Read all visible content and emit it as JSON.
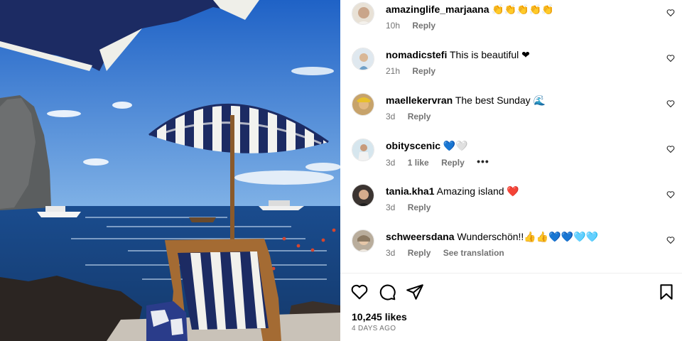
{
  "comments": [
    {
      "username": "amazinglife_marjaana",
      "text": "👏👏👏👏👏",
      "time": "10h",
      "likes": "",
      "reply": "Reply",
      "translate": "",
      "more": "",
      "avatar_color": "#c9a58a"
    },
    {
      "username": "nomadicstefi",
      "text": "This is beautiful ❤",
      "time": "21h",
      "likes": "",
      "reply": "Reply",
      "translate": "",
      "more": "",
      "avatar_color": "#b9cfe0"
    },
    {
      "username": "maellekervran",
      "text": "The best Sunday 🌊",
      "time": "3d",
      "likes": "",
      "reply": "Reply",
      "translate": "",
      "more": "",
      "avatar_color": "#d4a23a"
    },
    {
      "username": "obityscenic",
      "text": "💙🤍",
      "time": "3d",
      "likes": "1 like",
      "reply": "Reply",
      "translate": "",
      "more": "•••",
      "avatar_color": "#8fb3c7"
    },
    {
      "username": "tania.kha1",
      "text": "Amazing island ❤️",
      "time": "3d",
      "likes": "",
      "reply": "Reply",
      "translate": "",
      "more": "",
      "avatar_color": "#5a4d44"
    },
    {
      "username": "schweersdana",
      "text": "Wunderschön!!👍👍💙💙🩵🩵",
      "time": "3d",
      "likes": "",
      "reply": "Reply",
      "translate": "See translation",
      "more": "",
      "avatar_color": "#a99b8a"
    }
  ],
  "post": {
    "likes": "10,245 likes",
    "date": "4 DAYS AGO"
  },
  "icons": {
    "like": "heart-outline-icon",
    "comment": "comment-bubble-icon",
    "share": "paper-plane-icon",
    "save": "bookmark-icon",
    "comment_like": "heart-small-icon",
    "more": "ellipsis-icon"
  },
  "colors": {
    "text_primary": "#000000",
    "text_secondary": "#737373",
    "divider": "#efefef",
    "photo_sky": "#2f6fc4",
    "photo_sea": "#1d4f8f",
    "umbrella_navy": "#1b2a6b"
  }
}
